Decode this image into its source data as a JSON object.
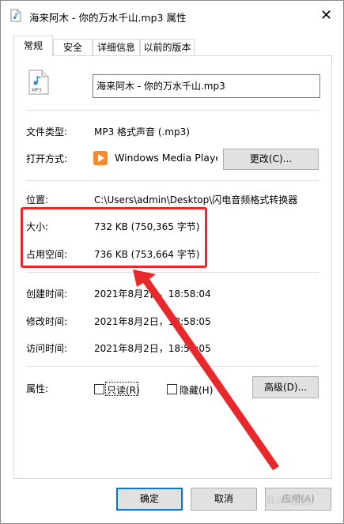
{
  "window": {
    "title": "海来阿木 - 你的万水千山.mp3 属性",
    "close_glyph": "✕"
  },
  "tabs": [
    {
      "label": "常规",
      "active": true
    },
    {
      "label": "安全",
      "active": false
    },
    {
      "label": "详细信息",
      "active": false
    },
    {
      "label": "以前的版本",
      "active": false
    }
  ],
  "general": {
    "file_icon": "mp3-file-icon",
    "filename": "海来阿木 - 你的万水千山.mp3",
    "file_type_label": "文件类型:",
    "file_type_value": "MP3 格式声音 (.mp3)",
    "open_with_label": "打开方式:",
    "open_with_value": "Windows Media Playe",
    "open_with_icon": "media-player-icon",
    "change_button": "更改(C)...",
    "location_label": "位置:",
    "location_value": "C:\\Users\\admin\\Desktop\\闪电音频格式转换器",
    "size_label": "大小:",
    "size_value": "732 KB (750,365 字节)",
    "disk_size_label": "占用空间:",
    "disk_size_value": "736 KB (753,664 字节)",
    "created_label": "创建时间:",
    "created_value": "2021年8月2日，18:58:04",
    "modified_label": "修改时间:",
    "modified_value": "2021年8月2日，18:58:05",
    "accessed_label": "访问时间:",
    "accessed_value": "2021年8月2日，18:58:05",
    "attributes_label": "属性:",
    "readonly_label": "只读(R)",
    "readonly_checked": false,
    "hidden_label": "隐藏(H)",
    "hidden_checked": false,
    "advanced_button": "高级(D)..."
  },
  "footer": {
    "ok_button": "确定",
    "cancel_button": "取消",
    "apply_button": "应用(A)"
  },
  "annotation": {
    "highlight_color": "#e8282b"
  },
  "watermark": {
    "text": "Bai经验"
  }
}
